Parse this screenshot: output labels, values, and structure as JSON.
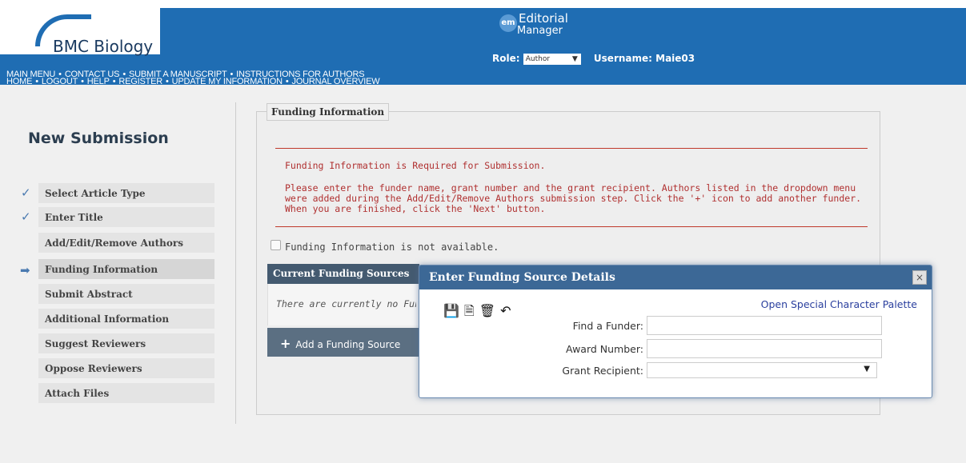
{
  "brand": {
    "journal_name": "BMC Biology",
    "em_badge": "em",
    "em_line1": "Editorial",
    "em_line2": "Manager"
  },
  "nav": {
    "row1": [
      "HOME",
      "LOGOUT",
      "HELP",
      "REGISTER",
      "UPDATE MY INFORMATION",
      "JOURNAL OVERVIEW"
    ],
    "row2": [
      "MAIN MENU",
      "CONTACT US",
      "SUBMIT A MANUSCRIPT",
      "INSTRUCTIONS FOR AUTHORS"
    ],
    "separator": "•"
  },
  "user": {
    "role_label": "Role:",
    "role_value": "Author",
    "username_text": "Username: Maie03"
  },
  "sidebar": {
    "title": "New Submission",
    "steps": [
      {
        "label": "Select Article Type",
        "status": "done"
      },
      {
        "label": "Enter Title",
        "status": "done"
      },
      {
        "label": "Add/Edit/Remove Authors",
        "status": ""
      },
      {
        "label": "Funding Information",
        "status": "current"
      },
      {
        "label": "Submit Abstract",
        "status": ""
      },
      {
        "label": "Additional Information",
        "status": ""
      },
      {
        "label": "Suggest Reviewers",
        "status": ""
      },
      {
        "label": "Oppose Reviewers",
        "status": ""
      },
      {
        "label": "Attach Files",
        "status": ""
      }
    ]
  },
  "main": {
    "section_title": "Funding Information",
    "required_msg": "Funding Information is Required for Submission.",
    "info_msg": "Please enter the funder name, grant number and the grant recipient. Authors listed in the dropdown menu were added during the Add/Edit/Remove Authors submission step. Click the '+' icon to add another funder. When you are finished, click the 'Next' button.",
    "not_available_label": "Funding Information is not available.",
    "current_sources_header": "Current Funding Sources",
    "no_sources_text": "There are currently no Funding Sources",
    "add_button": "Add a Funding Source"
  },
  "modal": {
    "title": "Enter Funding Source Details",
    "close": "×",
    "palette_link": "Open Special Character Palette",
    "fields": {
      "funder_label": "Find a Funder:",
      "funder_value": "",
      "award_label": "Award Number:",
      "award_value": "",
      "recipient_label": "Grant Recipient:",
      "recipient_value": ""
    }
  },
  "colors": {
    "header_blue": "#1f6db3",
    "modal_title": "#3c6896",
    "error_text": "#b03030",
    "table_header": "#445a70"
  }
}
